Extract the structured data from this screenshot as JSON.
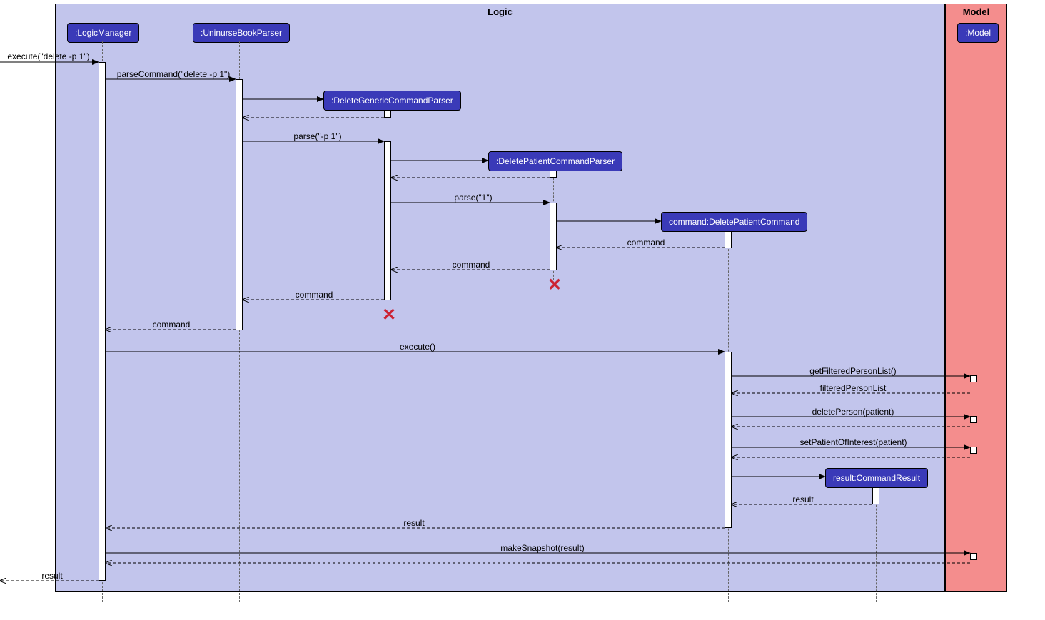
{
  "frames": {
    "logic": "Logic",
    "model": "Model"
  },
  "boxes": {
    "logicManager": ":LogicManager",
    "parser": ":UninurseBookParser",
    "dgcp": ":DeleteGenericCommandParser",
    "dpcp": ":DeletePatientCommandParser",
    "cmd": "command:DeletePatientCommand",
    "model": ":Model",
    "result": "result:CommandResult"
  },
  "messages": {
    "m1": "execute(\"delete -p 1\")",
    "m2": "parseCommand(\"delete -p 1\")",
    "m3": "parse(\"-p 1\")",
    "m4": "parse(\"1\")",
    "m5": "command",
    "m6": "command",
    "m7": "command",
    "m8": "command",
    "m9": "execute()",
    "m10": "getFilteredPersonList()",
    "m11": "filteredPersonList",
    "m12": "deletePerson(patient)",
    "m13": "setPatientOfInterest(patient)",
    "m14": "result",
    "m15": "result",
    "m16": "makeSnapshot(result)",
    "m17": "result"
  }
}
